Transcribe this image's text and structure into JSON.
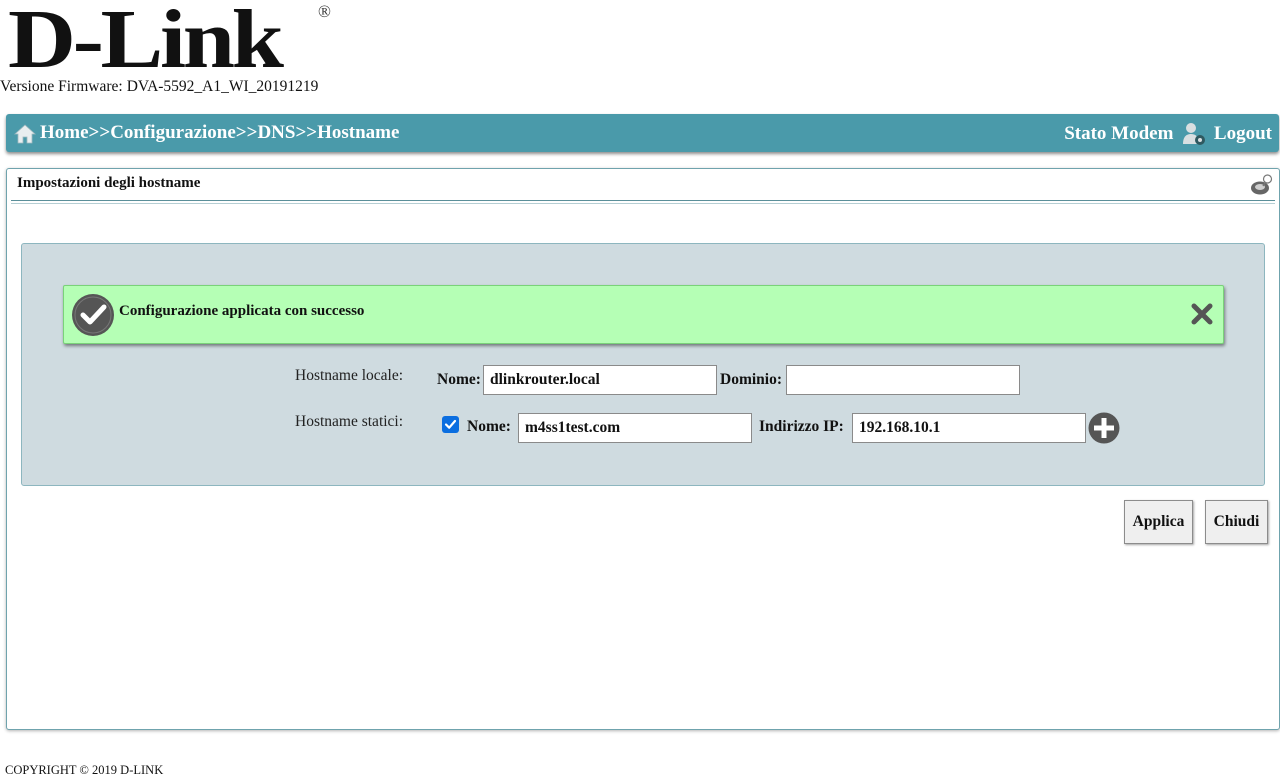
{
  "brand": {
    "logo_text": "D-Link",
    "logo_reg": "®"
  },
  "firmware": {
    "label": "Versione Firmware:",
    "value": "DVA-5592_A1_WI_20191219"
  },
  "nav": {
    "breadcrumb": "Home>>Configurazione>>DNS>>Hostname",
    "stato_modem": "Stato Modem",
    "logout": "Logout"
  },
  "panel": {
    "title": "Impostazioni degli hostname"
  },
  "alert": {
    "message": "Configurazione applicata con successo"
  },
  "form": {
    "local": {
      "row_label": "Hostname locale:",
      "name_label": "Nome:",
      "name_value": "dlinkrouter.local",
      "domain_label": "Dominio:",
      "domain_value": ""
    },
    "static": {
      "row_label": "Hostname statici:",
      "checked": true,
      "name_label": "Nome:",
      "name_value": "m4ss1test.com",
      "ip_label": "Indirizzo IP:",
      "ip_value": "192.168.10.1"
    }
  },
  "buttons": {
    "apply": "Applica",
    "close": "Chiudi"
  },
  "footer": {
    "copyright": "COPYRIGHT © 2019 D-LINK"
  },
  "colors": {
    "nav_bg": "#4a9aaa",
    "form_bg": "#cfdbe0",
    "alert_bg": "#b5ffb5",
    "checkbox": "#0b6ee0"
  },
  "icons": {
    "home": "home-icon",
    "user": "user-gear-icon",
    "help": "help-icon",
    "success": "check-circle-icon",
    "dismiss": "close-icon",
    "add": "plus-circle-icon"
  }
}
